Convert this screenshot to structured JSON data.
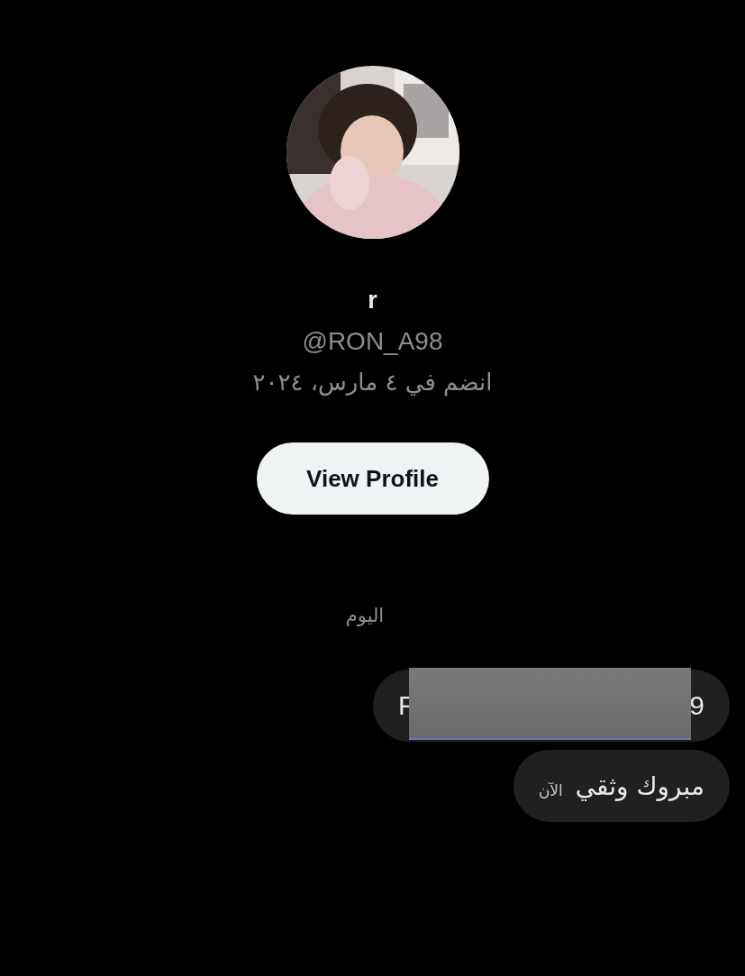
{
  "profile": {
    "name": "r",
    "handle": "@RON_A98",
    "joined": "انضم في ٤ مارس، ٢٠٢٤",
    "button": "View Profile"
  },
  "day_label": "اليوم",
  "messages": [
    {
      "start": "F",
      "end": "9",
      "redacted": true
    },
    {
      "text": "مبروك وثقي",
      "time": "الآن",
      "redacted": false
    }
  ]
}
